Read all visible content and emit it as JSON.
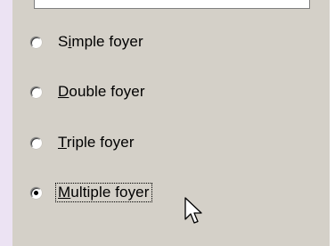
{
  "options": [
    {
      "pre": "S",
      "acc": "i",
      "post": "mple foyer",
      "checked": false
    },
    {
      "pre": "",
      "acc": "D",
      "post": "ouble foyer",
      "checked": false
    },
    {
      "pre": "",
      "acc": "T",
      "post": "riple foyer",
      "checked": false
    },
    {
      "pre": "",
      "acc": "M",
      "post": "ultiple foyer",
      "checked": true
    }
  ]
}
